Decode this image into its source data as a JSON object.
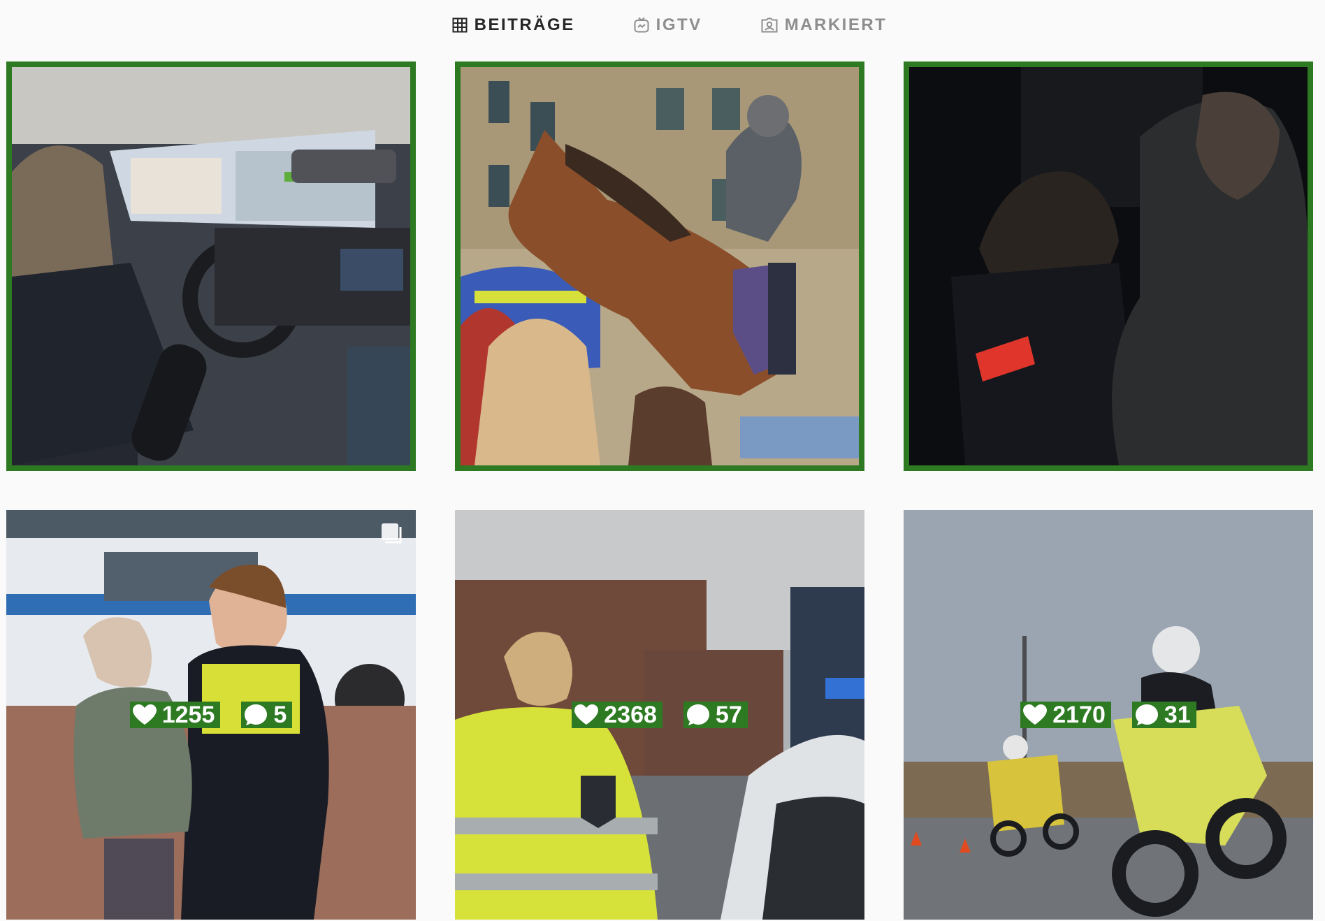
{
  "tabs": [
    {
      "label": "BEITRÄGE",
      "icon": "grid-icon",
      "active": true
    },
    {
      "label": "IGTV",
      "icon": "igtv-icon",
      "active": false
    },
    {
      "label": "MARKIERT",
      "icon": "tagged-icon",
      "active": false
    }
  ],
  "posts": [
    {
      "description": "police officer driving car, RØDE microphone",
      "framed": true
    },
    {
      "description": "mounted police officer with horse, children petting",
      "framed": true
    },
    {
      "description": "officer in dark with red POLIZEI armband",
      "framed": true
    },
    {
      "likes": "1255",
      "comments": "5",
      "multi": true
    },
    {
      "likes": "2368",
      "comments": "57"
    },
    {
      "likes": "2170",
      "comments": "31"
    }
  ],
  "colors": {
    "accent_green": "#2d7a22",
    "tab_active": "#262626",
    "tab_inactive": "#8e8e8e"
  }
}
